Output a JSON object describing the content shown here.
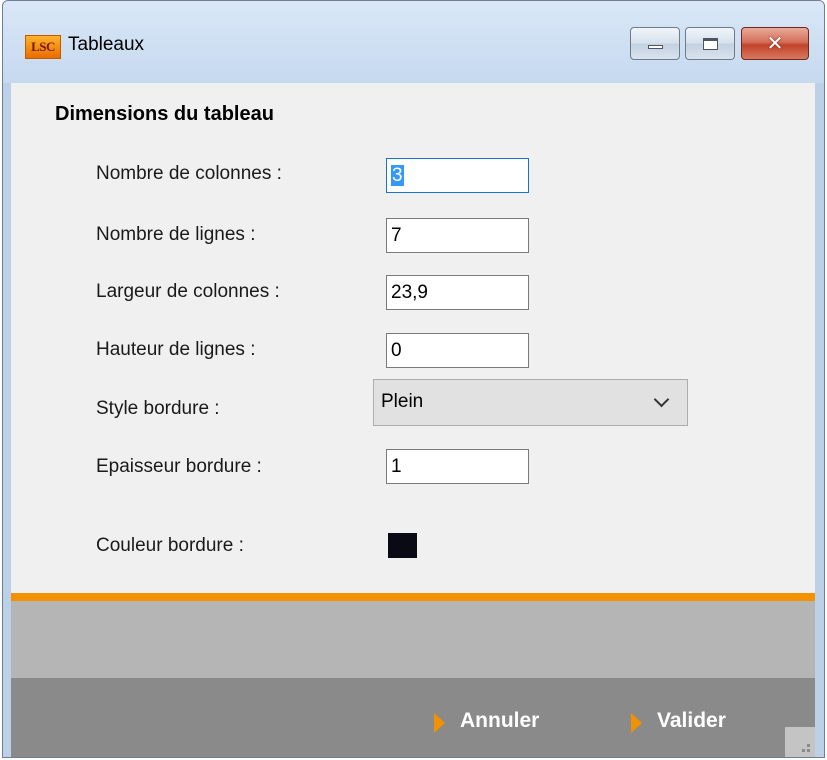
{
  "window": {
    "app_icon_text": "LSC",
    "title": "Tableaux"
  },
  "section_title": "Dimensions du tableau",
  "fields": {
    "columns": {
      "label": "Nombre de colonnes :",
      "value": "3"
    },
    "rows": {
      "label": "Nombre de lignes :",
      "value": "7"
    },
    "column_width": {
      "label": "Largeur de colonnes :",
      "value": "23,9"
    },
    "row_height": {
      "label": "Hauteur de lignes :",
      "value": "0"
    },
    "border_style": {
      "label": "Style bordure :",
      "value": "Plein"
    },
    "border_thickness": {
      "label": "Epaisseur bordure :",
      "value": "1"
    },
    "border_color": {
      "label": "Couleur bordure :",
      "color": "#0a0a14"
    }
  },
  "buttons": {
    "cancel": "Annuler",
    "ok": "Valider"
  },
  "colors": {
    "accent": "#f39200",
    "footer": "#8a8a8a",
    "band": "#b5b5b5",
    "panel": "#f0f0f0"
  }
}
